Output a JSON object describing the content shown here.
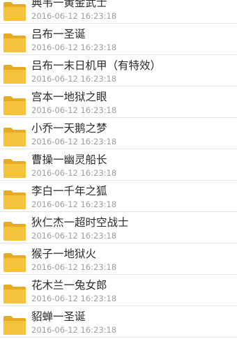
{
  "file_list": {
    "items": [
      {
        "name": "典韦一黄金武士",
        "date": "2016-06-12 16:23:18",
        "icon": "folder-icon"
      },
      {
        "name": "吕布一圣诞",
        "date": "2016-06-12 16:23:18",
        "icon": "folder-icon"
      },
      {
        "name": "吕布一末日机甲（有特效）",
        "date": "2016-06-12 16:23:18",
        "icon": "folder-icon"
      },
      {
        "name": "宫本一地狱之眼",
        "date": "2016-06-12 16:23:18",
        "icon": "folder-icon"
      },
      {
        "name": "小乔一天鹅之梦",
        "date": "2016-06-12 16:23:18",
        "icon": "folder-icon"
      },
      {
        "name": "曹操一幽灵船长",
        "date": "2016-06-12 16:23:18",
        "icon": "folder-icon"
      },
      {
        "name": "李白一千年之狐",
        "date": "2016-06-12 16:23:18",
        "icon": "folder-icon"
      },
      {
        "name": "狄仁杰一超时空战士",
        "date": "2016-06-12 16:23:18",
        "icon": "folder-icon"
      },
      {
        "name": "猴子一地狱火",
        "date": "2016-06-12 16:23:18",
        "icon": "folder-icon"
      },
      {
        "name": "花木兰一兔女郎",
        "date": "2016-06-12 16:23:18",
        "icon": "folder-icon"
      },
      {
        "name": "貂蝉一圣诞",
        "date": "2016-06-12 16:23:18",
        "icon": "folder-icon"
      }
    ]
  },
  "colors": {
    "folder_body": "#f5c33b",
    "folder_tab": "#e6ab22",
    "divider": "#e4e4e4",
    "name_text": "#2a2a2a",
    "date_text": "#9e9e9e"
  }
}
